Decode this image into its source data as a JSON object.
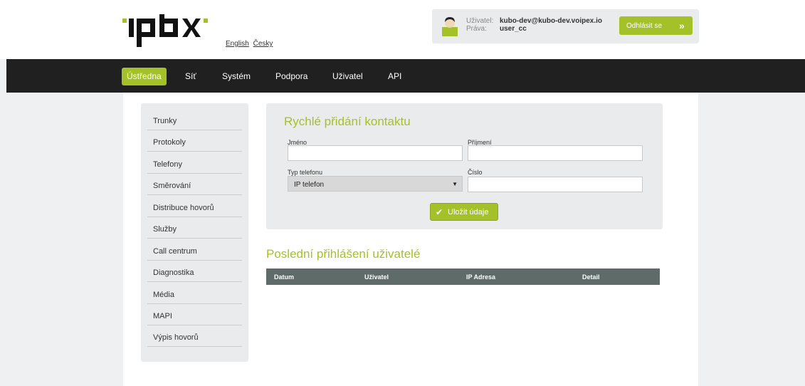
{
  "header": {
    "languages": [
      "English",
      "Česky"
    ],
    "user_label": "Uživatel:",
    "user_value": "kubo-dev@kubo-dev.voipex.io",
    "rights_label": "Práva:",
    "rights_value": "user_cc",
    "logout_label": "Odhlásit se",
    "logout_arrow": "»"
  },
  "nav": {
    "items": [
      {
        "label": "Ústředna",
        "active": true
      },
      {
        "label": "Síť"
      },
      {
        "label": "Systém"
      },
      {
        "label": "Podpora"
      },
      {
        "label": "Uživatel"
      },
      {
        "label": "API"
      }
    ]
  },
  "sidebar": {
    "items": [
      {
        "label": "Trunky"
      },
      {
        "label": "Protokoly"
      },
      {
        "label": "Telefony"
      },
      {
        "label": "Směrování"
      },
      {
        "label": "Distribuce hovorů"
      },
      {
        "label": "Služby"
      },
      {
        "label": "Call centrum"
      },
      {
        "label": "Diagnostika"
      },
      {
        "label": "Média"
      },
      {
        "label": "MAPI"
      },
      {
        "label": "Výpis hovorů"
      }
    ]
  },
  "quick_add": {
    "title": "Rychlé přidání kontaktu",
    "first_name_label": "Jméno",
    "first_name_value": "",
    "last_name_label": "Příjmení",
    "last_name_value": "",
    "phone_type_label": "Typ telefonu",
    "phone_type_value": "IP telefon",
    "number_label": "Číslo",
    "number_value": "",
    "save_label": "Uložit údaje"
  },
  "last_logins": {
    "title": "Poslední přihlášení uživatelé",
    "columns": [
      "Datum",
      "Uživatel",
      "IP Adresa",
      "Detail"
    ]
  },
  "colors": {
    "accent": "#a5c12a",
    "navbar": "#202020",
    "table_header": "#5e6b68",
    "panel": "#e9ebec"
  }
}
